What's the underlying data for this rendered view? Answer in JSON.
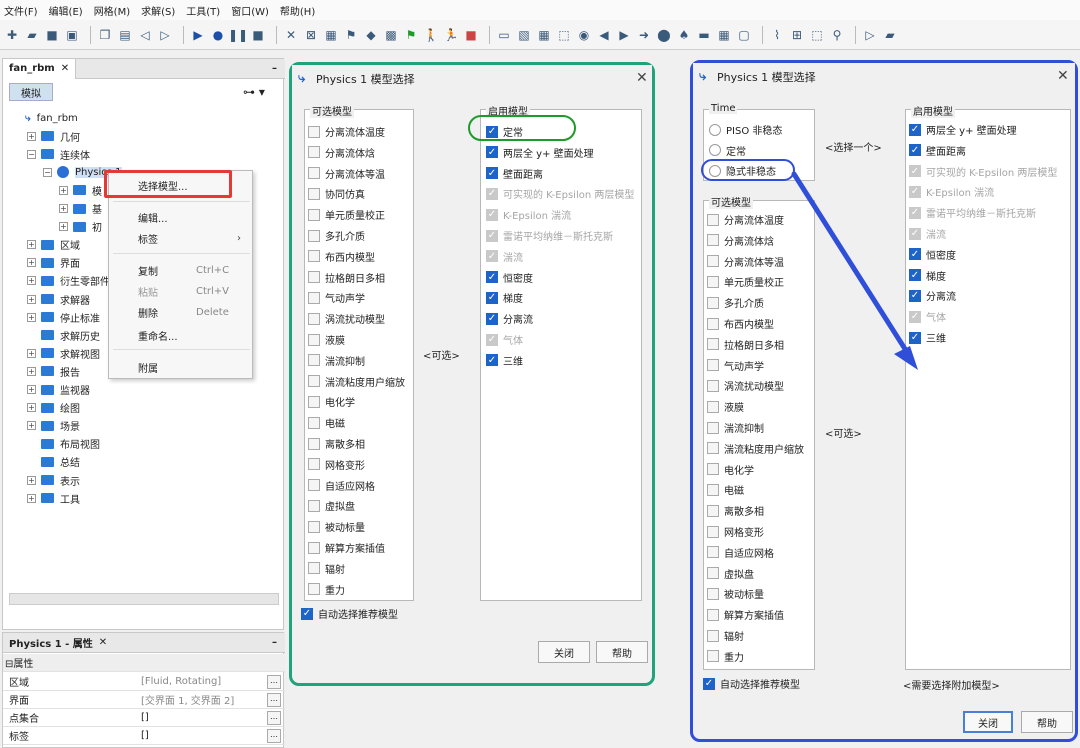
{
  "menu": [
    "文件(F)",
    "编辑(E)",
    "网格(M)",
    "求解(S)",
    "工具(T)",
    "窗口(W)",
    "帮助(H)"
  ],
  "left_panel": {
    "tab": "fan_rbm",
    "subtab": "模拟",
    "tree": [
      {
        "label": "fan_rbm",
        "level": 0,
        "exp": ""
      },
      {
        "label": "几何",
        "level": 1,
        "exp": "+"
      },
      {
        "label": "连续体",
        "level": 1,
        "exp": "-"
      },
      {
        "label": "Physics 1",
        "level": 2,
        "exp": "-"
      },
      {
        "label": "模",
        "level": 3,
        "exp": "+"
      },
      {
        "label": "基",
        "level": 3,
        "exp": "+"
      },
      {
        "label": "初",
        "level": 3,
        "exp": "+"
      },
      {
        "label": "区域",
        "level": 1,
        "exp": "+"
      },
      {
        "label": "界面",
        "level": 1,
        "exp": "+"
      },
      {
        "label": "衍生零部件",
        "level": 1,
        "exp": "+"
      },
      {
        "label": "求解器",
        "level": 1,
        "exp": "+"
      },
      {
        "label": "停止标准",
        "level": 1,
        "exp": "+"
      },
      {
        "label": "求解历史",
        "level": 1,
        "exp": ""
      },
      {
        "label": "求解视图",
        "level": 1,
        "exp": "+"
      },
      {
        "label": "报告",
        "level": 1,
        "exp": "+"
      },
      {
        "label": "监视器",
        "level": 1,
        "exp": "+"
      },
      {
        "label": "绘图",
        "level": 1,
        "exp": "+"
      },
      {
        "label": "场景",
        "level": 1,
        "exp": "+"
      },
      {
        "label": "布局视图",
        "level": 1,
        "exp": ""
      },
      {
        "label": "总结",
        "level": 1,
        "exp": ""
      },
      {
        "label": "表示",
        "level": 1,
        "exp": "+"
      },
      {
        "label": "工具",
        "level": 1,
        "exp": "+"
      }
    ]
  },
  "context_menu": [
    {
      "label": "选择模型...",
      "shortcut": "",
      "disabled": false
    },
    {
      "label": "编辑...",
      "shortcut": "",
      "disabled": false
    },
    {
      "label": "标签",
      "shortcut": "›",
      "disabled": false
    },
    {
      "label": "复制",
      "shortcut": "Ctrl+C",
      "disabled": false
    },
    {
      "label": "粘贴",
      "shortcut": "Ctrl+V",
      "disabled": true
    },
    {
      "label": "删除",
      "shortcut": "Delete",
      "disabled": false
    },
    {
      "label": "重命名...",
      "shortcut": "",
      "disabled": false
    },
    {
      "label": "附属",
      "shortcut": "",
      "disabled": false
    }
  ],
  "props": {
    "title": "Physics 1 - 属性",
    "section": "属性",
    "rows": [
      {
        "k": "区域",
        "v": "[Fluid, Rotating]"
      },
      {
        "k": "界面",
        "v": "[交界面 1, 交界面 2]"
      },
      {
        "k": "点集合",
        "v": "[]"
      },
      {
        "k": "标签",
        "v": "[]"
      }
    ]
  },
  "dialog1": {
    "title": "Physics 1 模型选择",
    "optional_label": "可选模型",
    "optional": [
      "分离流体温度",
      "分离流体焓",
      "分离流体等温",
      "协同仿真",
      "单元质量校正",
      "多孔介质",
      "布西内模型",
      "拉格朗日多相",
      "气动声学",
      "涡流扰动模型",
      "液膜",
      "湍流抑制",
      "湍流粘度用户缩放",
      "电化学",
      "电磁",
      "离散多相",
      "网格变形",
      "自适应网格",
      "虚拟盘",
      "被动标量",
      "解算方案插值",
      "辐射",
      "重力"
    ],
    "middle": "<可选>",
    "enabled_label": "启用模型",
    "enabled": [
      {
        "label": "定常",
        "state": "on"
      },
      {
        "label": "两层全 y+ 壁面处理",
        "state": "on"
      },
      {
        "label": "壁面距离",
        "state": "on"
      },
      {
        "label": "可实现的 K-Epsilon 两层模型",
        "state": "dis"
      },
      {
        "label": "K-Epsilon 湍流",
        "state": "dis"
      },
      {
        "label": "雷诺平均纳维－斯托克斯",
        "state": "dis"
      },
      {
        "label": "湍流",
        "state": "dis"
      },
      {
        "label": "恒密度",
        "state": "on"
      },
      {
        "label": "梯度",
        "state": "on"
      },
      {
        "label": "分离流",
        "state": "on"
      },
      {
        "label": "气体",
        "state": "dis"
      },
      {
        "label": "三维",
        "state": "on"
      }
    ],
    "auto": "自动选择推荐模型",
    "close": "关闭",
    "help": "帮助"
  },
  "dialog2": {
    "title": "Physics 1 模型选择",
    "time_label": "Time",
    "time": [
      "PISO 非稳态",
      "定常",
      "隐式非稳态"
    ],
    "choose_one": "<选择一个>",
    "optional_label": "可选模型",
    "optional": [
      "分离流体温度",
      "分离流体焓",
      "分离流体等温",
      "单元质量校正",
      "多孔介质",
      "布西内模型",
      "拉格朗日多相",
      "气动声学",
      "涡流扰动模型",
      "液膜",
      "湍流抑制",
      "湍流粘度用户缩放",
      "电化学",
      "电磁",
      "离散多相",
      "网格变形",
      "自适应网格",
      "虚拟盘",
      "被动标量",
      "解算方案插值",
      "辐射",
      "重力"
    ],
    "middle": "<可选>",
    "enabled_label": "启用模型",
    "enabled": [
      {
        "label": "两层全 y+ 壁面处理",
        "state": "on"
      },
      {
        "label": "壁面距离",
        "state": "on"
      },
      {
        "label": "可实现的 K-Epsilon 两层模型",
        "state": "dis"
      },
      {
        "label": "K-Epsilon 湍流",
        "state": "dis"
      },
      {
        "label": "雷诺平均纳维－斯托克斯",
        "state": "dis"
      },
      {
        "label": "湍流",
        "state": "dis"
      },
      {
        "label": "恒密度",
        "state": "on"
      },
      {
        "label": "梯度",
        "state": "on"
      },
      {
        "label": "分离流",
        "state": "on"
      },
      {
        "label": "气体",
        "state": "dis"
      },
      {
        "label": "三维",
        "state": "on"
      }
    ],
    "need_more": "<需要选择附加模型>",
    "auto": "自动选择推荐模型",
    "close": "关闭",
    "help": "帮助"
  },
  "colors": {
    "green": "#1fa37a",
    "blue": "#2f4fd8",
    "red": "#e53935",
    "accent": "#1e63c8"
  }
}
